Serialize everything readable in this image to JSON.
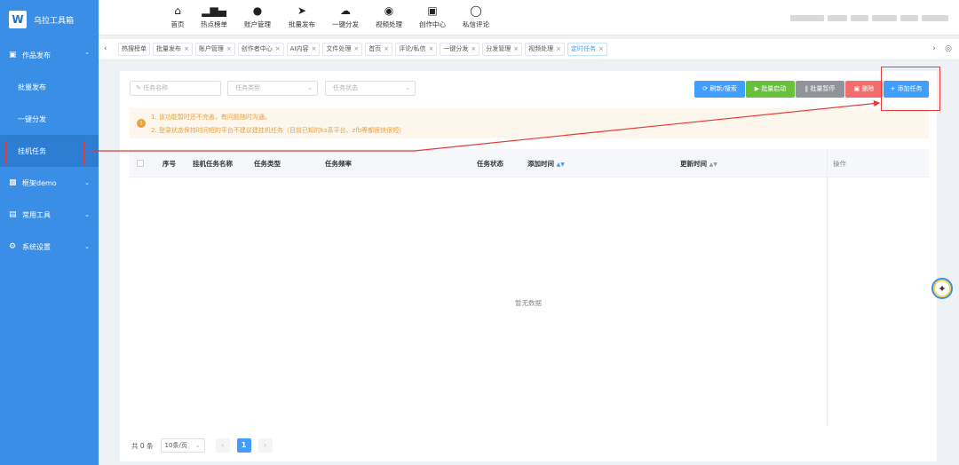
{
  "app": {
    "title": "乌拉工具箱",
    "logo_letter": "W"
  },
  "sidebar": {
    "groups": [
      {
        "label": "作品发布",
        "icon": "briefcase-icon",
        "expanded": true,
        "items": [
          {
            "label": "批量发布"
          },
          {
            "label": "一键分发"
          },
          {
            "label": "挂机任务",
            "active": true
          }
        ]
      },
      {
        "label": "框架demo",
        "icon": "monitor-icon"
      },
      {
        "label": "常用工具",
        "icon": "toolbox-icon"
      },
      {
        "label": "系统设置",
        "icon": "gear-icon"
      }
    ]
  },
  "topnav": [
    {
      "label": "首页",
      "icon": "home-icon"
    },
    {
      "label": "热点榜单",
      "icon": "bar-chart-icon"
    },
    {
      "label": "账户管理",
      "icon": "user-icon"
    },
    {
      "label": "批量发布",
      "icon": "paper-plane-icon"
    },
    {
      "label": "一键分发",
      "icon": "cloud-upload-icon"
    },
    {
      "label": "视频处理",
      "icon": "film-icon"
    },
    {
      "label": "创作中心",
      "icon": "inbox-icon"
    },
    {
      "label": "私信评论",
      "icon": "chat-icon"
    }
  ],
  "tabs": [
    {
      "label": "热搜榜单",
      "closable": false
    },
    {
      "label": "批量发布",
      "closable": true
    },
    {
      "label": "账户管理",
      "closable": true
    },
    {
      "label": "创作者中心",
      "closable": true
    },
    {
      "label": "AI内容",
      "closable": true
    },
    {
      "label": "文件处理",
      "closable": true
    },
    {
      "label": "首页",
      "closable": true
    },
    {
      "label": "评论/私信",
      "closable": true
    },
    {
      "label": "一键分发",
      "closable": true
    },
    {
      "label": "分发管理",
      "closable": true
    },
    {
      "label": "视频处理",
      "closable": true
    },
    {
      "label": "定时任务",
      "closable": true,
      "active": true
    }
  ],
  "filters": {
    "task_name_placeholder": "任务名称",
    "task_type_placeholder": "任务类型",
    "task_status_placeholder": "任务状态"
  },
  "toolbar": {
    "refresh_label": "刷新/搜索",
    "batch_start_label": "批量启动",
    "batch_pause_label": "批量暂停",
    "delete_label": "删除",
    "add_task_label": "添加任务"
  },
  "notice": {
    "line1": "1. 该功能暂时还不完善，有问题随时沟通。",
    "line2": "2. 登录状态保持时间短的平台不建议建挂机任务（目前已知的ks系平台、zfb等都很快很短）"
  },
  "table": {
    "columns": [
      "序号",
      "挂机任务名称",
      "任务类型",
      "任务频率",
      "任务状态",
      "添加时间",
      "更新时间",
      "操作"
    ],
    "rows": [],
    "empty_text": "暂无数据"
  },
  "pagination": {
    "total_text": "共 0 条",
    "page_size": "10条/页",
    "current_page": "1"
  },
  "colors": {
    "sidebar": "#3a8ee6",
    "primary": "#409eff",
    "success": "#67c23a",
    "info": "#909399",
    "danger": "#f56c6c",
    "warning": "#e6a23c",
    "annotation": "#e53935"
  }
}
